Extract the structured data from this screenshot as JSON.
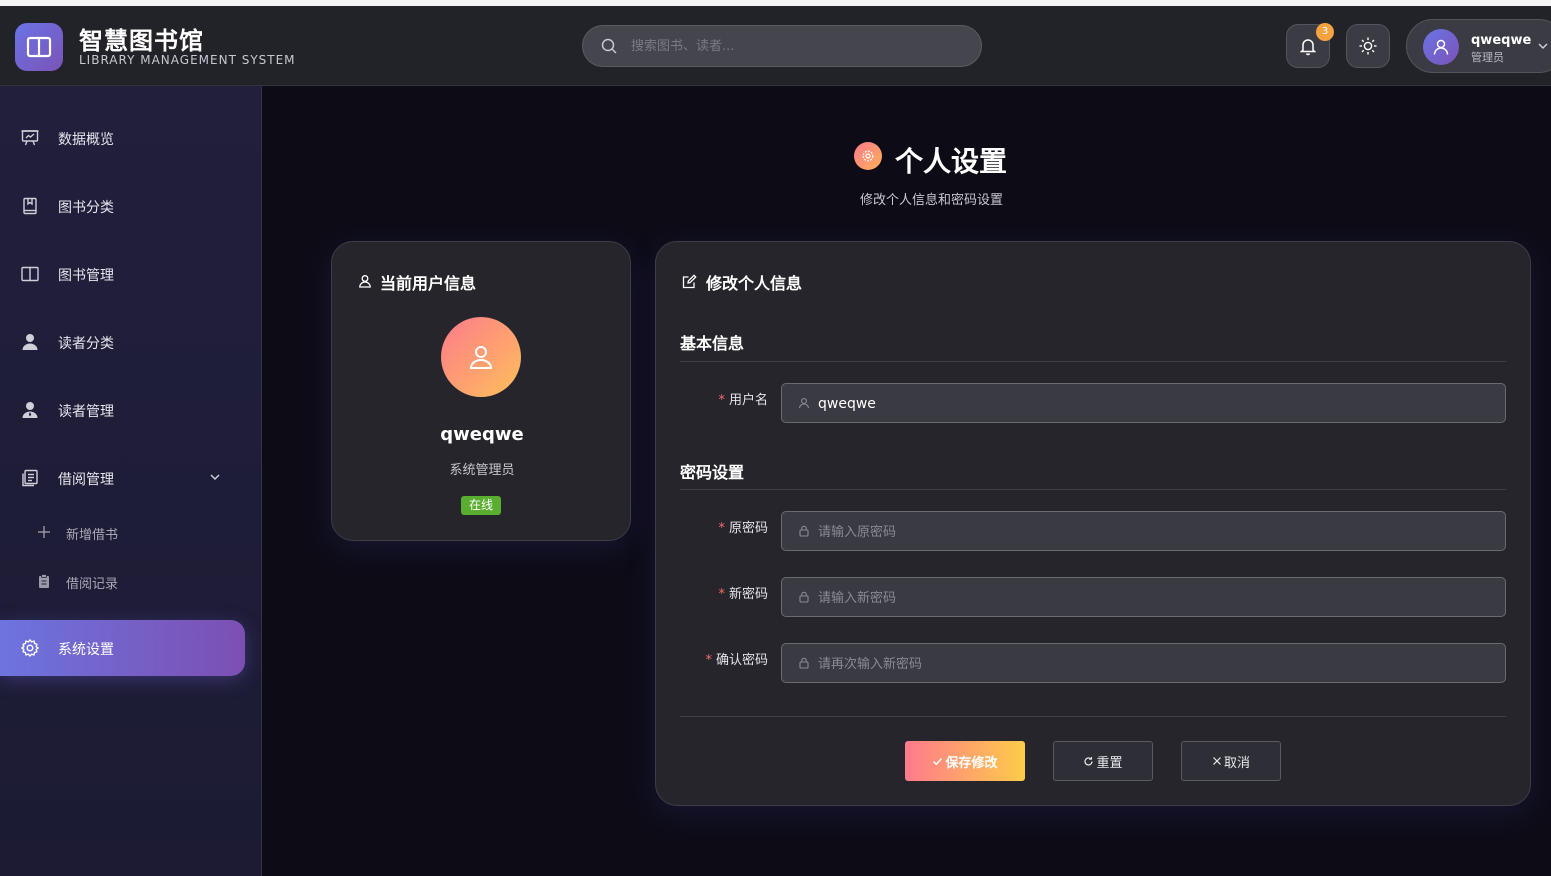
{
  "header": {
    "app_title": "智慧图书馆",
    "app_subtitle": "LIBRARY MANAGEMENT SYSTEM",
    "search_placeholder": "搜索图书、读者...",
    "notification_count": "3",
    "user_name": "qweqwe",
    "user_role": "管理员"
  },
  "sidebar": {
    "items": [
      {
        "label": "数据概览",
        "icon": "monitor-icon"
      },
      {
        "label": "图书分类",
        "icon": "book-icon"
      },
      {
        "label": "图书管理",
        "icon": "open-book-icon"
      },
      {
        "label": "读者分类",
        "icon": "user-icon"
      },
      {
        "label": "读者管理",
        "icon": "user-manage-icon"
      },
      {
        "label": "借阅管理",
        "icon": "document-icon",
        "expanded": true
      }
    ],
    "sub_items": [
      {
        "label": "新增借书",
        "icon": "plus-icon"
      },
      {
        "label": "借阅记录",
        "icon": "clipboard-icon"
      }
    ],
    "active_item": {
      "label": "系统设置",
      "icon": "gear-icon"
    }
  },
  "page": {
    "title": "个人设置",
    "subtitle": "修改个人信息和密码设置"
  },
  "user_card": {
    "heading": "当前用户信息",
    "name": "qweqwe",
    "role": "系统管理员",
    "status": "在线"
  },
  "form": {
    "heading": "修改个人信息",
    "basic_section": "基本信息",
    "username_label": "用户名",
    "username_value": "qweqwe",
    "password_section": "密码设置",
    "old_password_label": "原密码",
    "old_password_placeholder": "请输入原密码",
    "new_password_label": "新密码",
    "new_password_placeholder": "请输入新密码",
    "confirm_password_label": "确认密码",
    "confirm_password_placeholder": "请再次输入新密码",
    "save_label": "保存修改",
    "reset_label": "重置",
    "cancel_label": "取消"
  },
  "colors": {
    "accent_purple": "#6d74df",
    "accent_gradient_orange": "#ff7a8c",
    "accent_gradient_yellow": "#fdcc48",
    "status_green": "#5aae2f",
    "required_red": "#f56c6c"
  }
}
